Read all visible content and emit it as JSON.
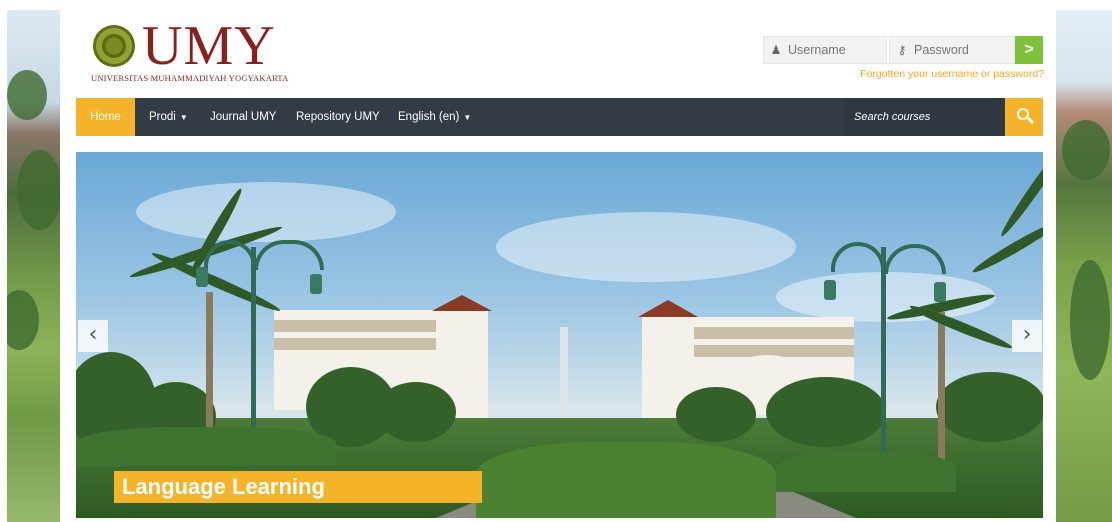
{
  "header": {
    "logo_text": "UMY",
    "logo_subtitle": "UNIVERSITAS MUHAMMADIYAH YOGYAKARTA"
  },
  "login": {
    "username_placeholder": "Username",
    "password_placeholder": "Password",
    "submit_glyph": ">",
    "forgot_link": "Forgotten your username or password?"
  },
  "nav": {
    "home": "Home",
    "prodi": "Prodi",
    "journal": "Journal UMY",
    "repository": "Repository UMY",
    "language": "English (en)",
    "search_placeholder": "Search courses"
  },
  "slider": {
    "caption": "Language Learning",
    "prev_glyph": "‹",
    "next_glyph": "›"
  },
  "colors": {
    "accent": "#f5b32a",
    "navbar": "#333c44",
    "login_button": "#7ec23b",
    "brand": "#8a1f1c"
  }
}
